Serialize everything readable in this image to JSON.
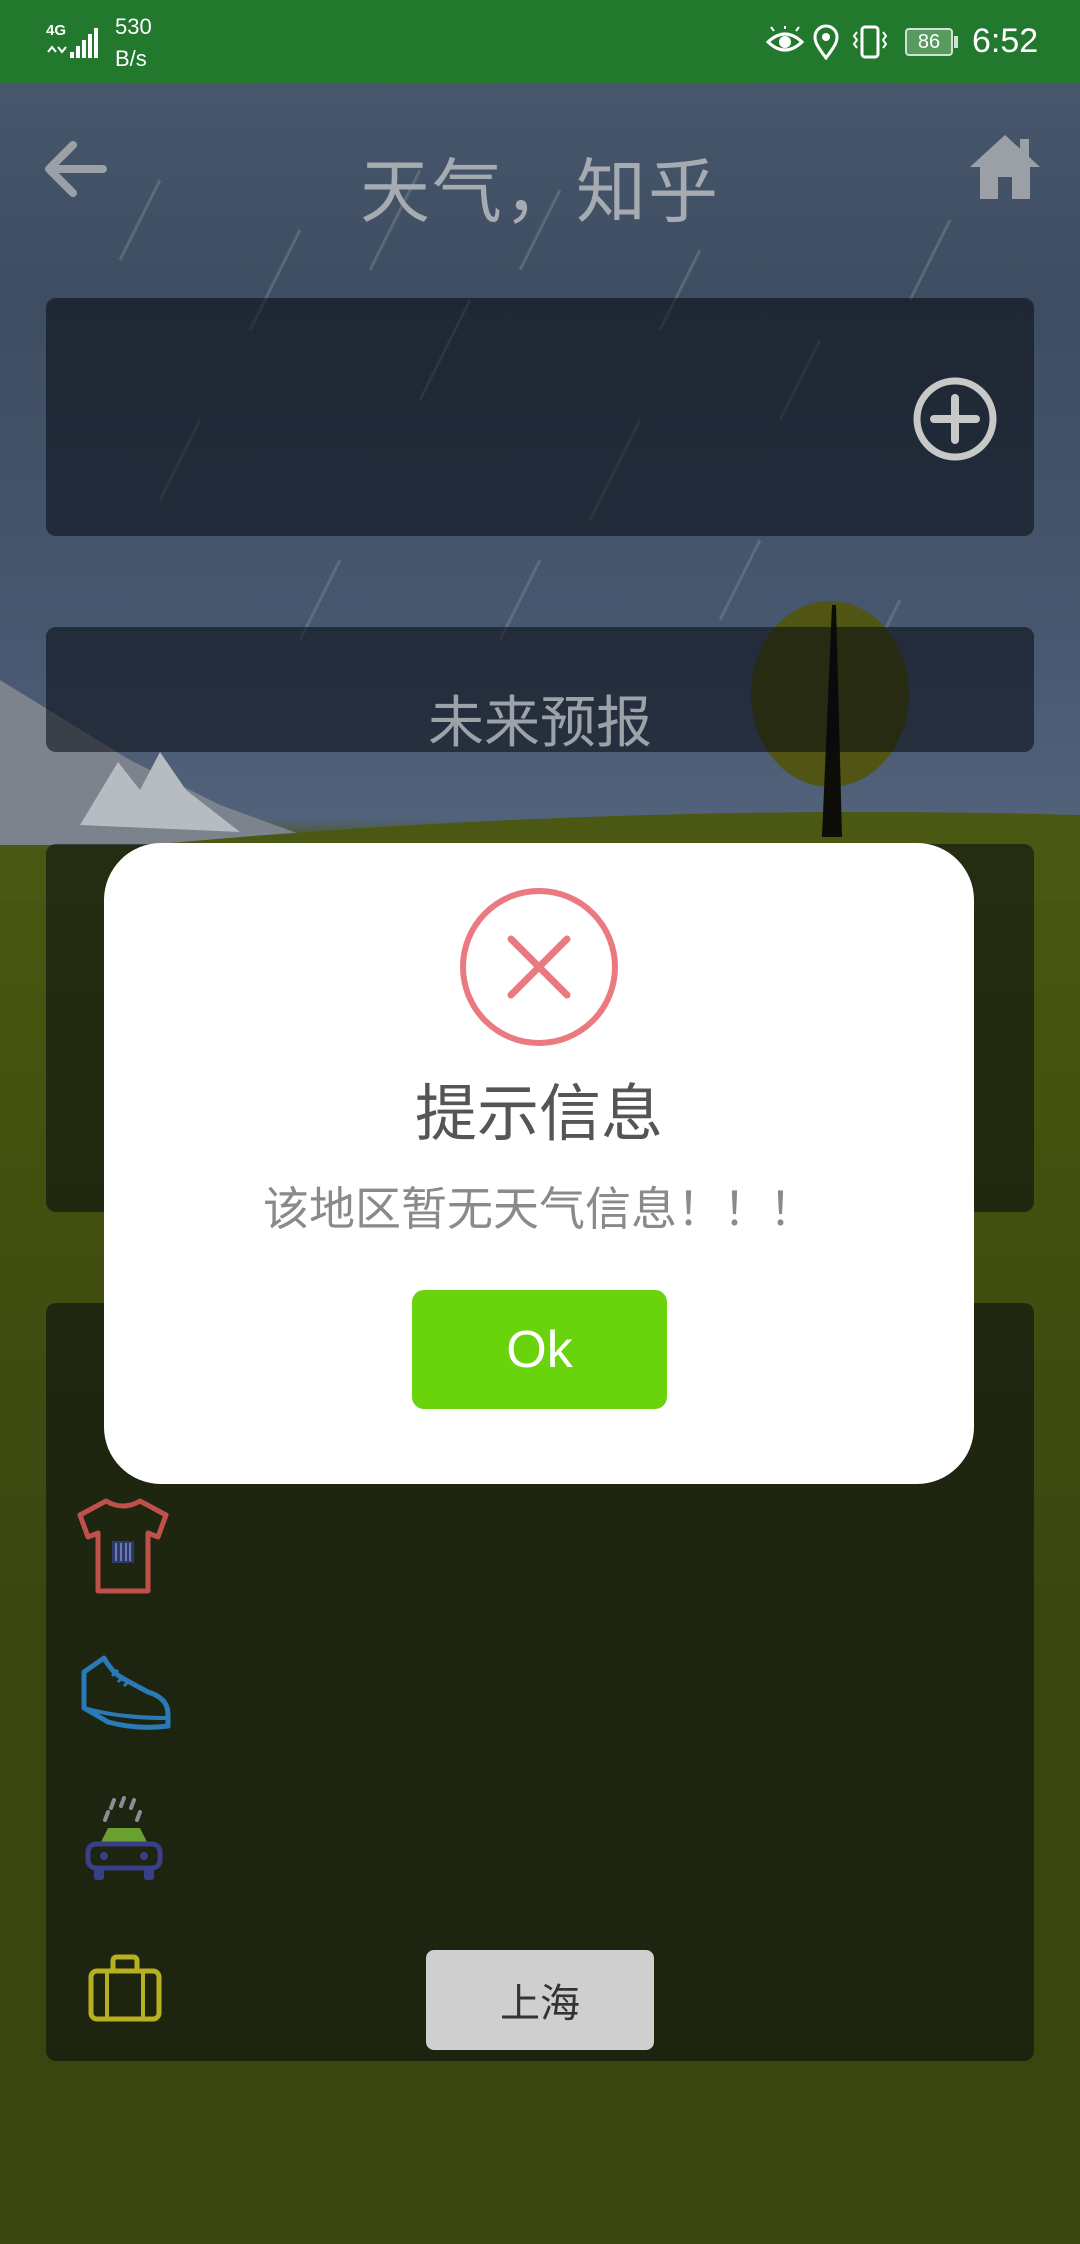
{
  "status_bar": {
    "network": "4G",
    "speed_value": "530",
    "speed_unit": "B/s",
    "battery": "86",
    "time": "6:52",
    "bg_color": "#22782c",
    "icons": [
      "signal-icon",
      "eye-icon",
      "location-icon",
      "vibrate-icon",
      "battery-icon"
    ]
  },
  "header": {
    "title": "天气，知乎",
    "back_icon": "back-arrow-icon",
    "home_icon": "home-icon"
  },
  "weather_card": {
    "add_icon": "add-circle-icon"
  },
  "forecast": {
    "label": "未来预报"
  },
  "lifestyle": {
    "icons": [
      "shirt-icon",
      "shoe-icon",
      "car-wash-icon",
      "suitcase-icon"
    ]
  },
  "city_button": {
    "label": "上海"
  },
  "dialog": {
    "icon": "error-circle-icon",
    "title": "提示信息",
    "message": "该地区暂无天气信息！！！",
    "ok_label": "Ok",
    "ok_color": "#69d40c",
    "error_color": "#ea7a80"
  }
}
